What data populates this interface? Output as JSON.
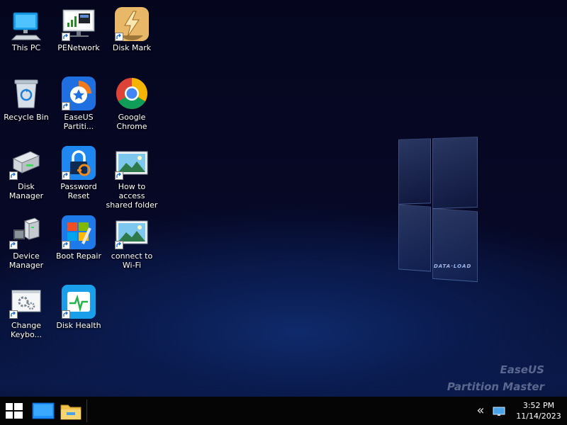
{
  "desktop": {
    "icons": [
      {
        "label": "This PC",
        "icon": "computer-icon"
      },
      {
        "label": "PENetwork",
        "icon": "network-monitor-icon"
      },
      {
        "label": "Disk Mark",
        "icon": "lightning-icon"
      },
      {
        "label": "Recycle Bin",
        "icon": "recycle-bin-icon"
      },
      {
        "label": "EaseUS\nPartiti...",
        "icon": "easeus-partition-icon"
      },
      {
        "label": "Google\nChrome",
        "icon": "chrome-icon"
      },
      {
        "label": "Disk Manager",
        "icon": "disk-drive-icon"
      },
      {
        "label": "Password\nReset",
        "icon": "padlock-key-icon"
      },
      {
        "label": "How to access\nshared folder",
        "icon": "picture-icon"
      },
      {
        "label": "Device\nManager",
        "icon": "device-manager-icon"
      },
      {
        "label": "Boot Repair",
        "icon": "boot-repair-icon"
      },
      {
        "label": "connect to\nWi-Fi",
        "icon": "picture-icon"
      },
      {
        "label": "Change\nKeybo...",
        "icon": "gears-window-icon"
      },
      {
        "label": "Disk Health",
        "icon": "disk-health-icon"
      }
    ]
  },
  "wallpaper": {
    "logo_text": "DATA·LOAD",
    "watermark_line1": "EaseUS",
    "watermark_line2": "Partition Master"
  },
  "taskbar": {
    "start_icon": "windows-start-icon",
    "pinned": [
      "desktop-blue-icon",
      "file-explorer-icon"
    ],
    "tray": {
      "chevron": "«",
      "network_icon": "network-monitor-icon",
      "time": "3:52 PM",
      "date": "11/14/2023"
    }
  },
  "colors": {
    "taskbar": "#050505",
    "accent_blue": "#1e90ff",
    "folder_yellow": "#f2c24a"
  }
}
